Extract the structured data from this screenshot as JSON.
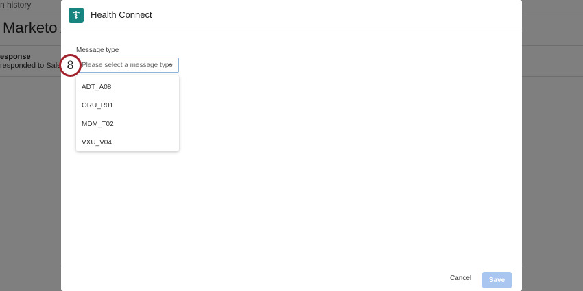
{
  "background": {
    "history_link": "n history",
    "page_title": "Marketo Act",
    "response_label": "esponse",
    "response_text": "responded to Salesfo"
  },
  "modal": {
    "title": "Health Connect",
    "icon": "caduceus-icon",
    "accent_color": "#16847f",
    "field": {
      "label": "Message type",
      "placeholder": "Please select a message type"
    },
    "options": [
      "ADT_A08",
      "ORU_R01",
      "MDM_T02",
      "VXU_V04"
    ],
    "footer": {
      "cancel_label": "Cancel",
      "save_label": "Save"
    }
  },
  "step_badge": {
    "number": "8",
    "color": "#a2222c"
  }
}
